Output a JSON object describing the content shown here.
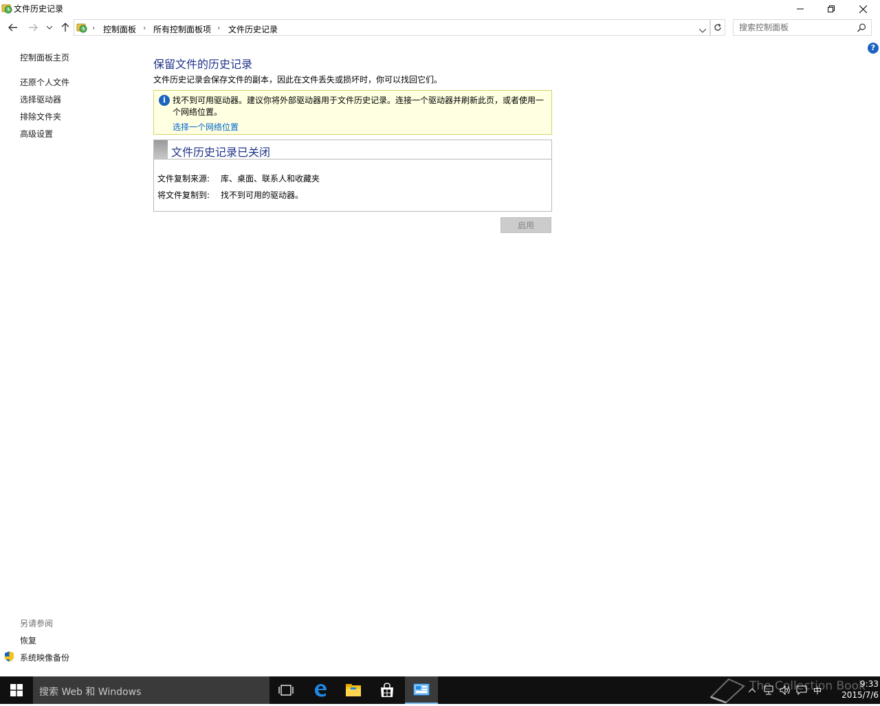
{
  "window": {
    "title": "文件历史记录"
  },
  "address": {
    "crumbs": [
      "控制面板",
      "所有控制面板项",
      "文件历史记录"
    ],
    "search_placeholder": "搜索控制面板"
  },
  "sidebar": {
    "home": "控制面板主页",
    "items": [
      {
        "label": "还原个人文件"
      },
      {
        "label": "选择驱动器"
      },
      {
        "label": "排除文件夹"
      },
      {
        "label": "高级设置"
      }
    ],
    "see_also_title": "另请参阅",
    "see_also": [
      {
        "label": "恢复"
      },
      {
        "label": "系统映像备份"
      }
    ]
  },
  "main": {
    "heading": "保留文件的历史记录",
    "description": "文件历史记录会保存文件的副本，因此在文件丢失或损坏时，你可以找回它们。",
    "warning": {
      "text": "找不到可用驱动器。建议你将外部驱动器用于文件历史记录。连接一个驱动器并刷新此页，或者使用一个网络位置。",
      "link": "选择一个网络位置"
    },
    "status": {
      "title": "文件历史记录已关闭",
      "source_label": "文件复制来源:",
      "source_value": "库、桌面、联系人和收藏夹",
      "target_label": "将文件复制到:",
      "target_value": "找不到可用的驱动器。"
    },
    "enable_button": "启用"
  },
  "taskbar": {
    "search_placeholder": "搜索 Web 和 Windows",
    "ime": "中",
    "time": "9:33",
    "date": "2015/7/6",
    "watermark": "The Collection Book"
  },
  "colors": {
    "heading": "#1e3287",
    "link": "#0066cc",
    "warning_bg": "#ffffe1",
    "taskbar": "#101010"
  }
}
